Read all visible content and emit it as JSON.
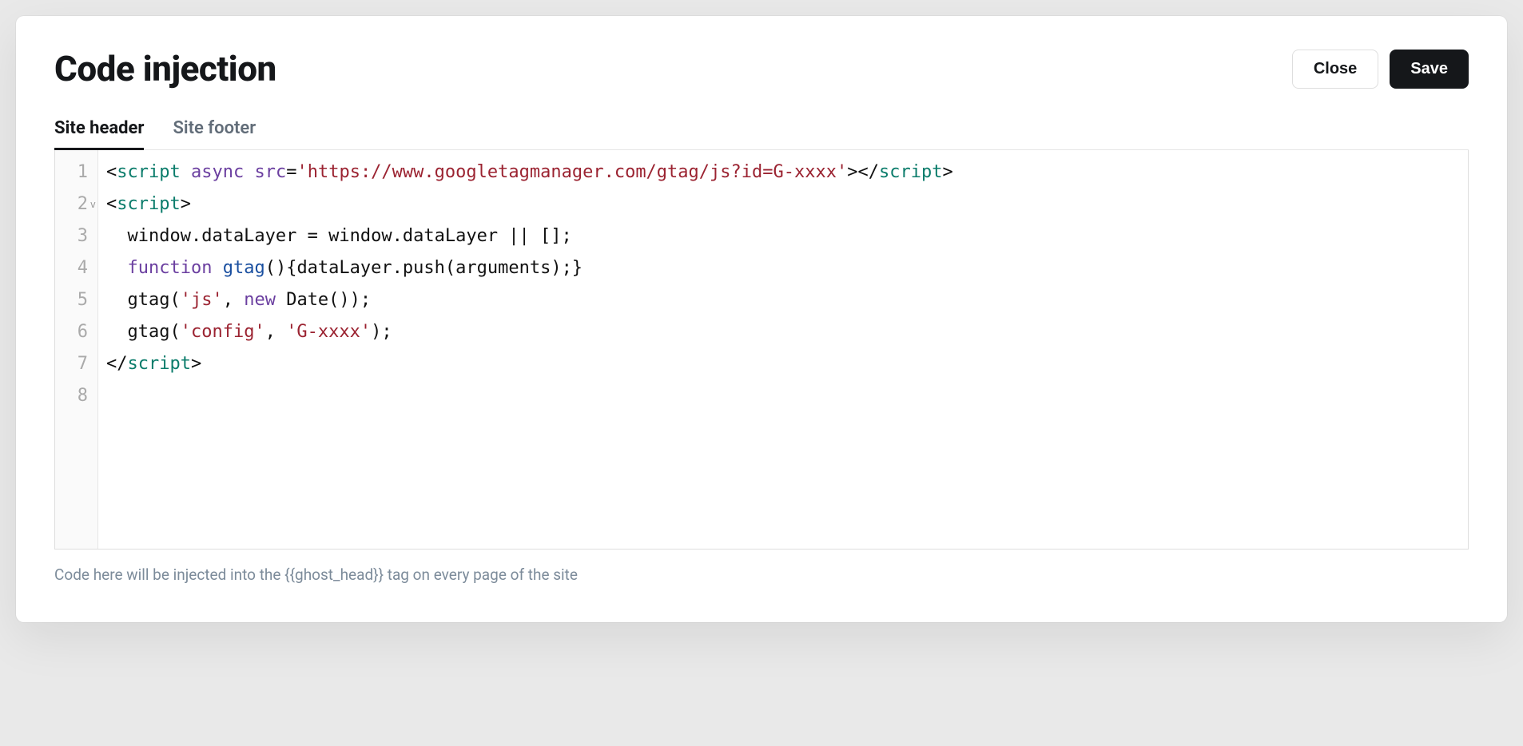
{
  "header": {
    "title": "Code injection",
    "close_label": "Close",
    "save_label": "Save"
  },
  "tabs": {
    "site_header": "Site header",
    "site_footer": "Site footer",
    "active": "site_header"
  },
  "editor": {
    "line_numbers": [
      "1",
      "2",
      "3",
      "4",
      "5",
      "6",
      "7",
      "8"
    ],
    "fold_line": 2,
    "lines": [
      [
        {
          "t": "<",
          "c": "bracket"
        },
        {
          "t": "script",
          "c": "tag"
        },
        {
          "t": " ",
          "c": ""
        },
        {
          "t": "async",
          "c": "attr"
        },
        {
          "t": " ",
          "c": ""
        },
        {
          "t": "src",
          "c": "attr"
        },
        {
          "t": "=",
          "c": "bracket"
        },
        {
          "t": "'https://www.googletagmanager.com/gtag/js?id=G-xxxx'",
          "c": "str"
        },
        {
          "t": ">",
          "c": "bracket"
        },
        {
          "t": "</",
          "c": "bracket"
        },
        {
          "t": "script",
          "c": "tag"
        },
        {
          "t": ">",
          "c": "bracket"
        }
      ],
      [
        {
          "t": "<",
          "c": "bracket"
        },
        {
          "t": "script",
          "c": "tag"
        },
        {
          "t": ">",
          "c": "bracket"
        }
      ],
      [
        {
          "t": "  window.dataLayer = window.dataLayer || [];",
          "c": ""
        }
      ],
      [
        {
          "t": "  ",
          "c": ""
        },
        {
          "t": "function",
          "c": "kw"
        },
        {
          "t": " ",
          "c": ""
        },
        {
          "t": "gtag",
          "c": "fn"
        },
        {
          "t": "(){dataLayer.push(arguments);}",
          "c": ""
        }
      ],
      [
        {
          "t": "  gtag(",
          "c": ""
        },
        {
          "t": "'js'",
          "c": "str"
        },
        {
          "t": ", ",
          "c": ""
        },
        {
          "t": "new",
          "c": "kw"
        },
        {
          "t": " Date());",
          "c": ""
        }
      ],
      [
        {
          "t": "  gtag(",
          "c": ""
        },
        {
          "t": "'config'",
          "c": "str"
        },
        {
          "t": ", ",
          "c": ""
        },
        {
          "t": "'G-xxxx'",
          "c": "str"
        },
        {
          "t": ");",
          "c": ""
        }
      ],
      [
        {
          "t": "</",
          "c": "bracket"
        },
        {
          "t": "script",
          "c": "tag"
        },
        {
          "t": ">",
          "c": "bracket"
        }
      ],
      [
        {
          "t": "",
          "c": ""
        }
      ]
    ]
  },
  "helper_text": "Code here will be injected into the {{ghost_head}} tag on every page of the site"
}
